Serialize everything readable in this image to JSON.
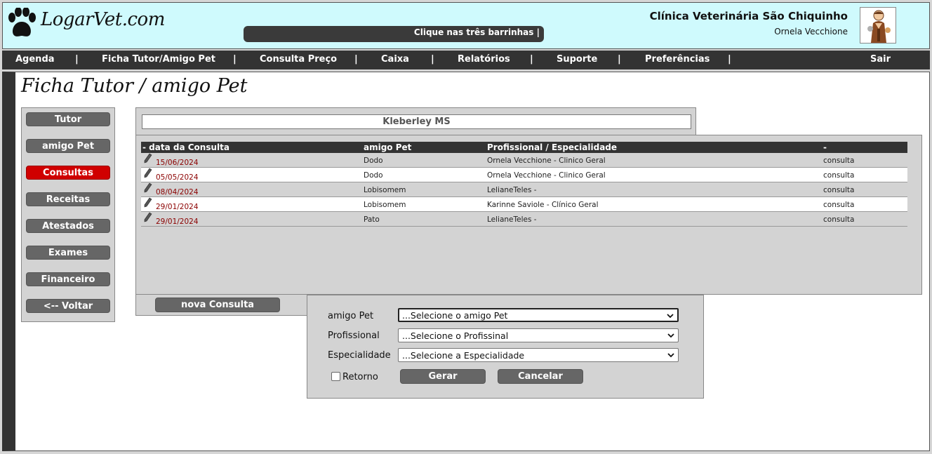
{
  "header": {
    "logo_text": "LogarVet.com",
    "marquee_text": "Clique nas três barrinhas |",
    "clinic_name": "Clínica Veterinária São Chiquinho",
    "user_name": "Ornela Vecchione"
  },
  "menu": {
    "items": [
      "Agenda",
      "Ficha Tutor/Amigo Pet",
      "Consulta Preço",
      "Caixa",
      "Relatórios",
      "Suporte",
      "Preferências"
    ],
    "separator": "|",
    "logout": "Sair"
  },
  "page": {
    "title": "Ficha Tutor / amigo Pet"
  },
  "sidenav": {
    "items": [
      "Tutor",
      "amigo Pet",
      "Consultas",
      "Receitas",
      "Atestados",
      "Exames",
      "Financeiro",
      "<-- Voltar"
    ],
    "active": "Consultas"
  },
  "tutor": {
    "name": "Kleberley MS"
  },
  "table": {
    "headers": [
      "- data da Consulta",
      "amigo Pet",
      "Profissional / Especialidade",
      "-"
    ],
    "rows": [
      {
        "date": "15/06/2024",
        "pet": "Dodo",
        "prof": "Ornela Vecchione  -  Clinico Geral",
        "type": "consulta"
      },
      {
        "date": "05/05/2024",
        "pet": "Dodo",
        "prof": "Ornela Vecchione  -  Clinico Geral",
        "type": "consulta"
      },
      {
        "date": "08/04/2024",
        "pet": "Lobisomem",
        "prof": "LelianeTeles  -",
        "type": "consulta"
      },
      {
        "date": "29/01/2024",
        "pet": "Lobisomem",
        "prof": "Karinne Saviole  -  Clínico Geral",
        "type": "consulta"
      },
      {
        "date": "29/01/2024",
        "pet": "Pato",
        "prof": "LelianeTeles  -",
        "type": "consulta"
      }
    ]
  },
  "nova_consulta": {
    "label": "nova Consulta"
  },
  "form": {
    "pet_label": "amigo Pet",
    "pet_value": "...Selecione o amigo Pet",
    "prof_label": "Profissional",
    "prof_value": "...Selecione o Profissinal",
    "esp_label": "Especialidade",
    "esp_value": "...Selecione a Especialidade",
    "retorno_label": "Retorno",
    "retorno_checked": false,
    "gerar_label": "Gerar",
    "cancelar_label": "Cancelar"
  },
  "colors": {
    "header_bg": "#cffafd",
    "bar": "#333333",
    "active": "#d00000",
    "date": "#8b0000"
  }
}
